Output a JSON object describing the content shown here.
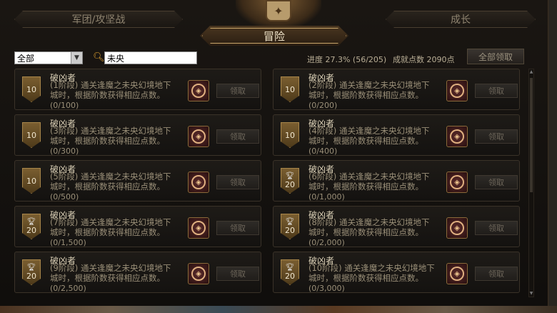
{
  "tabs": {
    "left": "军团/攻坚战",
    "right": "成长",
    "active": "冒险"
  },
  "filter": {
    "selected": "全部"
  },
  "search": {
    "value": "未央"
  },
  "stats": {
    "progress": "进度  27.3% (56/205)",
    "points": "成就点数  2090点"
  },
  "claim_all_label": "全部领取",
  "cards": [
    {
      "badge": "10",
      "trophy": false,
      "title": "破凶者",
      "desc": "(1阶段) 通关逢魔之未央幻境地下城时，根据阶数获得相应点数。",
      "count": "(0/100)",
      "claim": "领取"
    },
    {
      "badge": "10",
      "trophy": false,
      "title": "破凶者",
      "desc": "(2阶段) 通关逢魔之未央幻境地下城时，根据阶数获得相应点数。",
      "count": "(0/200)",
      "claim": "领取"
    },
    {
      "badge": "10",
      "trophy": false,
      "title": "破凶者",
      "desc": "(3阶段) 通关逢魔之未央幻境地下城时，根据阶数获得相应点数。",
      "count": "(0/300)",
      "claim": "领取"
    },
    {
      "badge": "10",
      "trophy": false,
      "title": "破凶者",
      "desc": "(4阶段) 通关逢魔之未央幻境地下城时，根据阶数获得相应点数。",
      "count": "(0/400)",
      "claim": "领取"
    },
    {
      "badge": "10",
      "trophy": false,
      "title": "破凶者",
      "desc": "(5阶段) 通关逢魔之未央幻境地下城时，根据阶数获得相应点数。",
      "count": "(0/500)",
      "claim": "领取"
    },
    {
      "badge": "20",
      "trophy": true,
      "title": "破凶者",
      "desc": "(6阶段) 通关逢魔之未央幻境地下城时，根据阶数获得相应点数。",
      "count": "(0/1,000)",
      "claim": "领取"
    },
    {
      "badge": "20",
      "trophy": true,
      "title": "破凶者",
      "desc": "(7阶段) 通关逢魔之未央幻境地下城时，根据阶数获得相应点数。",
      "count": "(0/1,500)",
      "claim": "领取"
    },
    {
      "badge": "20",
      "trophy": true,
      "title": "破凶者",
      "desc": "(8阶段) 通关逢魔之未央幻境地下城时，根据阶数获得相应点数。",
      "count": "(0/2,000)",
      "claim": "领取"
    },
    {
      "badge": "20",
      "trophy": true,
      "title": "破凶者",
      "desc": "(9阶段) 通关逢魔之未央幻境地下城时，根据阶数获得相应点数。",
      "count": "(0/2,500)",
      "claim": "领取"
    },
    {
      "badge": "20",
      "trophy": true,
      "title": "破凶者",
      "desc": "(10阶段) 通关逢魔之未央幻境地下城时，根据阶数获得相应点数。",
      "count": "(0/3,000)",
      "claim": "领取"
    }
  ]
}
